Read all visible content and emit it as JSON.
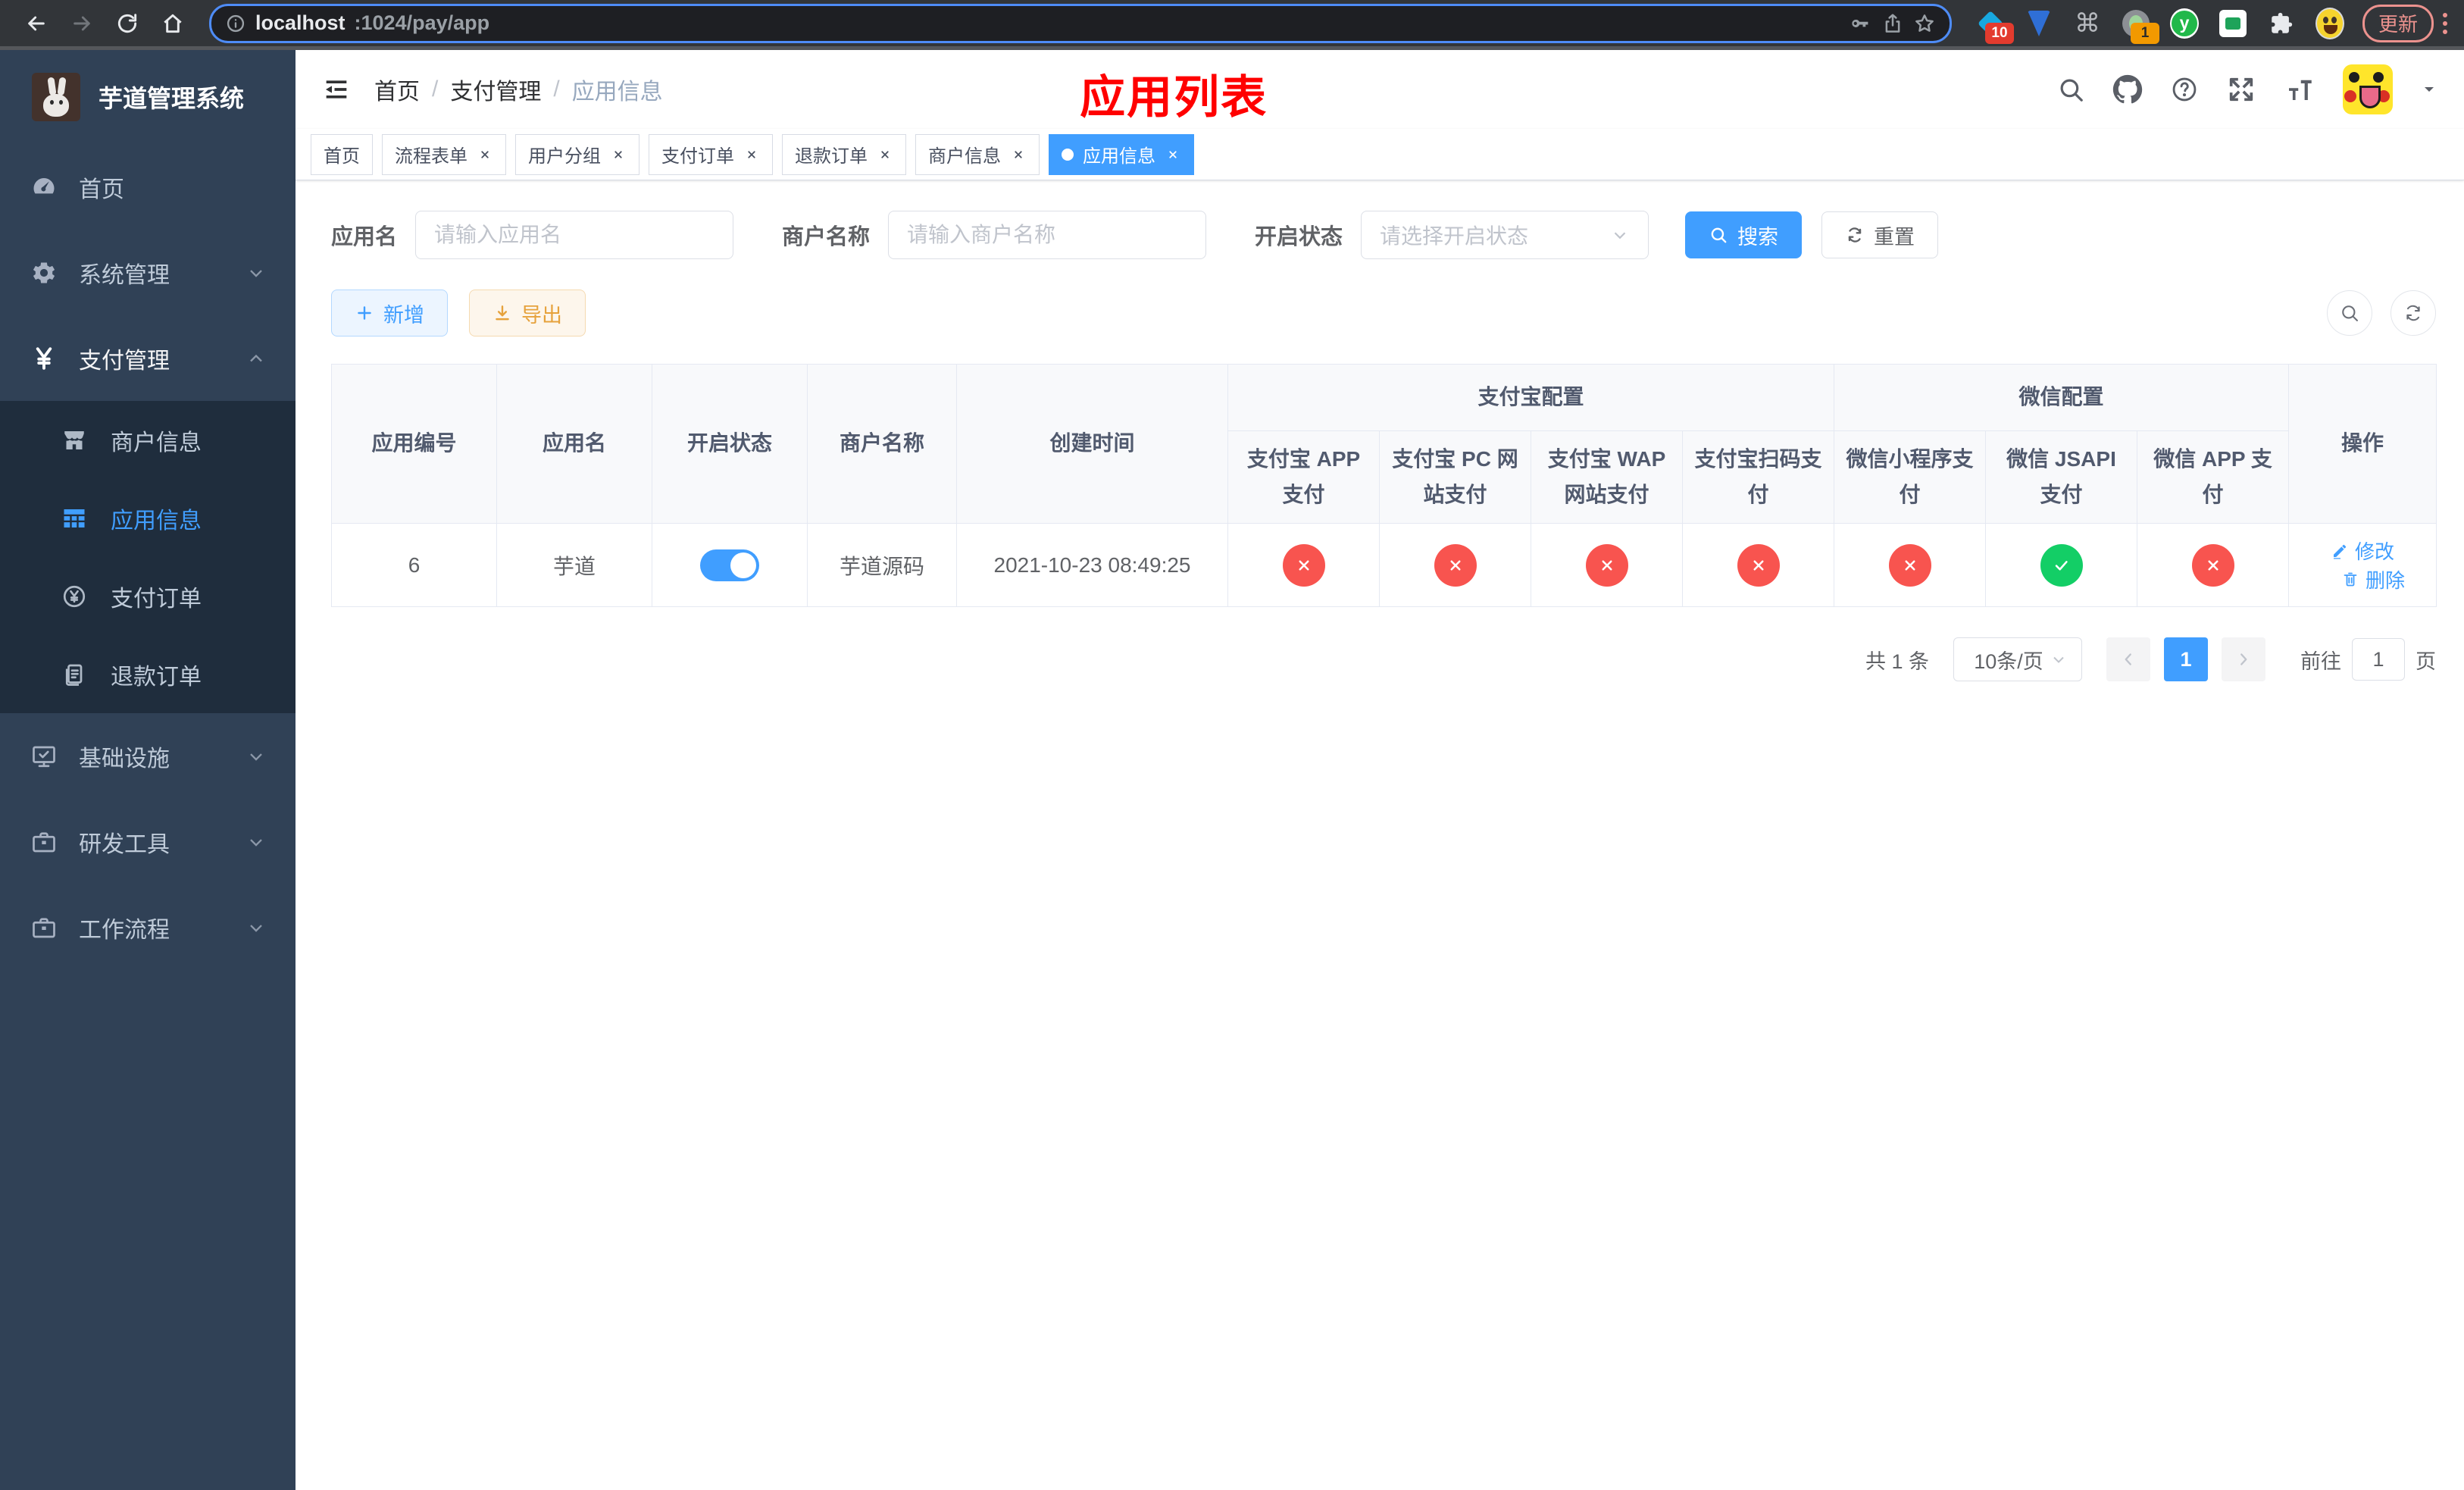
{
  "browser": {
    "url_host": "localhost",
    "url_rest": ":1024/pay/app",
    "update_label": "更新",
    "ext_cmd_glyph": "⌘",
    "ext_y_glyph": "y",
    "badge_a": "10",
    "badge_b": "1"
  },
  "sidebar": {
    "title": "芋道管理系统",
    "home": "首页",
    "system": "系统管理",
    "payment": "支付管理",
    "merchant_info": "商户信息",
    "app_info": "应用信息",
    "pay_order": "支付订单",
    "refund_order": "退款订单",
    "infra": "基础设施",
    "dev_tools": "研发工具",
    "workflow": "工作流程"
  },
  "navbar": {
    "breadcrumb": [
      "首页",
      "支付管理",
      "应用信息"
    ],
    "sep": "/",
    "page_title": "应用列表"
  },
  "tabs": [
    {
      "label": "首页"
    },
    {
      "label": "流程表单"
    },
    {
      "label": "用户分组"
    },
    {
      "label": "支付订单"
    },
    {
      "label": "退款订单"
    },
    {
      "label": "商户信息"
    },
    {
      "label": "应用信息"
    }
  ],
  "filters": {
    "app_name_label": "应用名",
    "app_name_placeholder": "请输入应用名",
    "merchant_label": "商户名称",
    "merchant_placeholder": "请输入商户名称",
    "status_label": "开启状态",
    "status_placeholder": "请选择开启状态",
    "search_label": "搜索",
    "reset_label": "重置"
  },
  "toolbar": {
    "add_label": "新增",
    "export_label": "导出"
  },
  "table": {
    "group_alipay": "支付宝配置",
    "group_wechat": "微信配置",
    "col_app_id": "应用编号",
    "col_app_name": "应用名",
    "col_status": "开启状态",
    "col_merchant": "商户名称",
    "col_created": "创建时间",
    "col_alipay_app": "支付宝 APP 支付",
    "col_alipay_pc": "支付宝 PC 网站支付",
    "col_alipay_wap": "支付宝 WAP 网站支付",
    "col_alipay_qr": "支付宝扫码支付",
    "col_wx_mini": "微信小程序支付",
    "col_wx_jsapi": "微信 JSAPI 支付",
    "col_wx_app": "微信 APP 支付",
    "col_actions": "操作",
    "row": {
      "id": "6",
      "name": "芋道",
      "enabled": true,
      "merchant": "芋道源码",
      "created_at": "2021-10-23 08:49:25",
      "statuses": [
        "no",
        "no",
        "no",
        "no",
        "no",
        "yes",
        "no"
      ],
      "edit_label": "修改",
      "delete_label": "删除"
    }
  },
  "pagination": {
    "total": "共 1 条",
    "page_size": "10条/页",
    "current_page": "1",
    "goto_label": "前往",
    "goto_value": "1",
    "page_unit": "页"
  },
  "colors": {
    "accent": "#409eff",
    "danger": "#f8544f",
    "success": "#13ce66",
    "title_red": "#ff0000",
    "sidebar_bg": "#304156",
    "submenu_bg": "#1f2d3d"
  }
}
